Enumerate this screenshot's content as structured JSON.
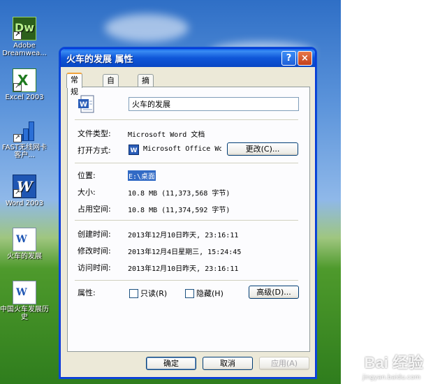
{
  "desktop": {
    "icons": [
      {
        "label": "Adobe Dreamwea...",
        "glyph": "Dw"
      },
      {
        "label": "Excel 2003"
      },
      {
        "label": "FAST无线网卡客户..."
      },
      {
        "label": "Word 2003"
      },
      {
        "label": "火车的发展"
      },
      {
        "label": "中国火车发展历史"
      }
    ]
  },
  "dialog": {
    "title": "火车的发展 属性",
    "tabs": [
      "常规",
      "自定义",
      "摘要"
    ],
    "file_name": "火车的发展",
    "fields": {
      "type_label": "文件类型:",
      "type_value": "Microsoft Word 文档",
      "open_label": "打开方式:",
      "open_value": "Microsoft Office Wo",
      "change_button": "更改(C)...",
      "location_label": "位置:",
      "location_value": "E:\\桌面",
      "size_label": "大小:",
      "size_value": "10.8 MB (11,373,568 字节)",
      "disk_label": "占用空间:",
      "disk_value": "10.8 MB (11,374,592 字节)",
      "created_label": "创建时间:",
      "created_value": "2013年12月10日昨天, 23:16:11",
      "modified_label": "修改时间:",
      "modified_value": "2013年12月4日星期三, 15:24:45",
      "accessed_label": "访问时间:",
      "accessed_value": "2013年12月10日昨天, 23:16:11",
      "attr_label": "属性:",
      "readonly_label": "只读(R)",
      "hidden_label": "隐藏(H)",
      "advanced_button": "高级(D)..."
    },
    "buttons": {
      "ok": "确定",
      "cancel": "取消",
      "apply": "应用(A)"
    },
    "title_help": "?",
    "title_close": "×"
  },
  "watermark": {
    "brand": "Bai 经验",
    "url": "jingyan.baidu.com"
  },
  "colors": {
    "titlebar": "#0a5fe8",
    "dialog_bg": "#ece9d8",
    "tab_highlight": "#f1a33c"
  }
}
